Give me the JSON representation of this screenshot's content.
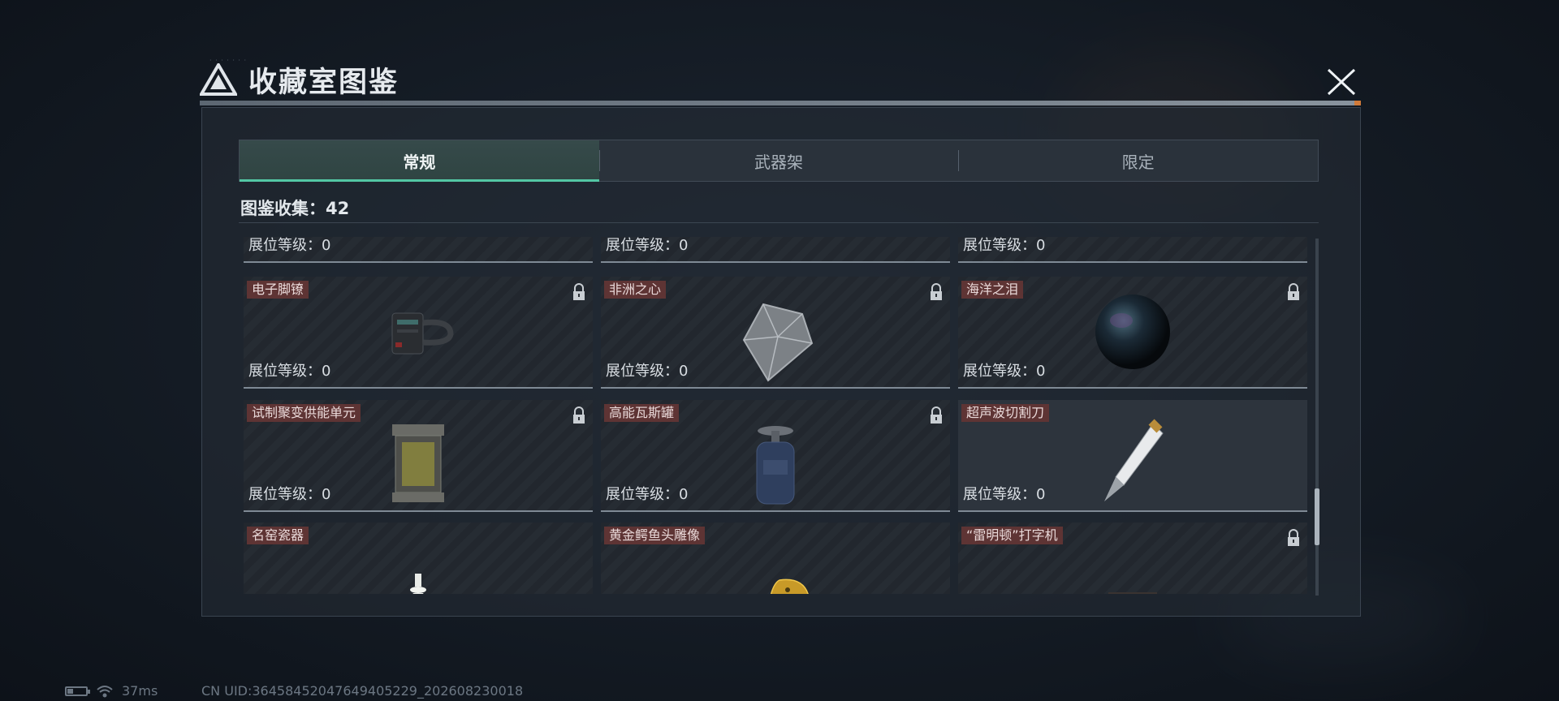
{
  "window": {
    "title": "收藏室图鉴",
    "close_icon": "close-icon",
    "logo_icon": "triangle-logo-icon"
  },
  "tabs": [
    {
      "label": "常规",
      "active": true
    },
    {
      "label": "武器架",
      "active": false
    },
    {
      "label": "限定",
      "active": false
    }
  ],
  "collection": {
    "label": "图鉴收集：",
    "count": "42"
  },
  "level_label": "展位等级：",
  "top_row": [
    {
      "level": "0"
    },
    {
      "level": "0"
    },
    {
      "level": "0"
    }
  ],
  "items": [
    {
      "name": "电子脚镣",
      "level": "0",
      "locked": true,
      "icon": "ankle-monitor-icon"
    },
    {
      "name": "非洲之心",
      "level": "0",
      "locked": true,
      "icon": "diamond-icon"
    },
    {
      "name": "海洋之泪",
      "level": "0",
      "locked": true,
      "icon": "pearl-icon"
    },
    {
      "name": "试制聚变供能单元",
      "level": "0",
      "locked": true,
      "icon": "fusion-cell-icon"
    },
    {
      "name": "高能瓦斯罐",
      "level": "0",
      "locked": true,
      "icon": "gas-canister-icon"
    },
    {
      "name": "超声波切割刀",
      "level": "0",
      "locked": false,
      "icon": "ultrasonic-cutter-icon"
    },
    {
      "name": "名窑瓷器",
      "level": "",
      "locked": false,
      "icon": "porcelain-vase-icon"
    },
    {
      "name": "黄金鳄鱼头雕像",
      "level": "",
      "locked": false,
      "icon": "golden-crocodile-icon"
    },
    {
      "name": "“雷明顿”打字机",
      "level": "",
      "locked": true,
      "icon": "typewriter-icon"
    }
  ],
  "status_bar": {
    "ping": "37ms",
    "battery_level": 0.3,
    "uid": "CN UID:3645845204764940522​9_202608230018"
  },
  "colors": {
    "accent": "#53c7a4",
    "name_tag": "#5e3434",
    "lock": "#c9ced3"
  }
}
